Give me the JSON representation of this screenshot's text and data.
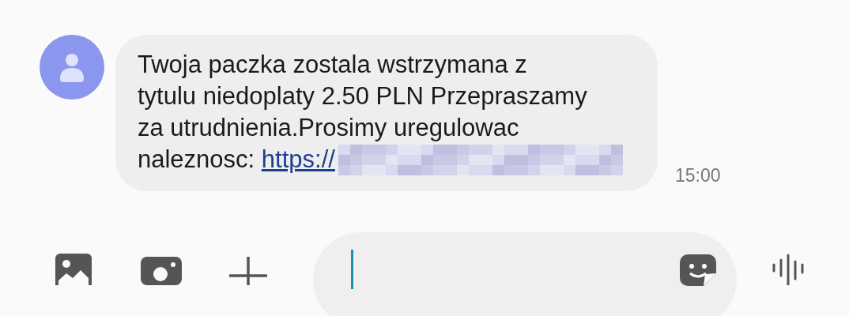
{
  "message": {
    "lines": [
      "Twoja paczka zostala wstrzymana z",
      "tytulu niedoplaty 2.50 PLN Przepraszamy",
      "za utrudnienia.Prosimy uregulowac",
      "naleznosc: "
    ],
    "link": "https://",
    "time": "15:00"
  },
  "composer": {
    "focused": true
  }
}
